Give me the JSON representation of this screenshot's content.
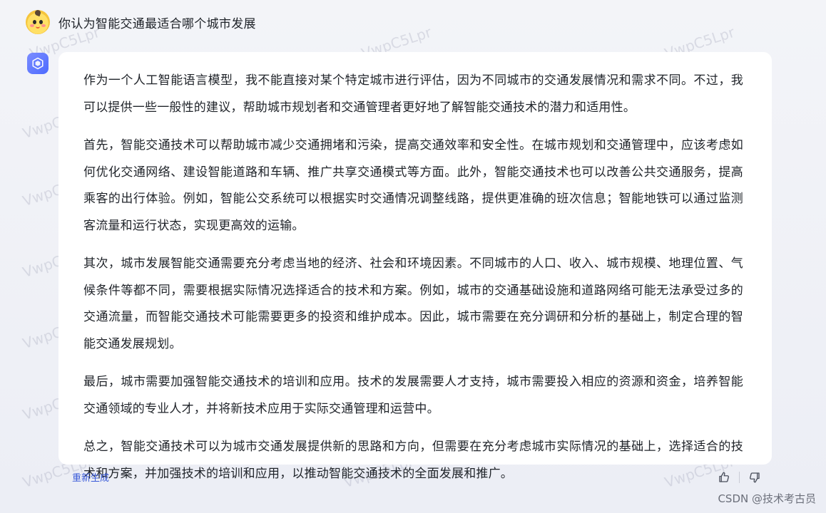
{
  "user": {
    "avatar_icon": "duck-avatar-icon",
    "question": "你认为智能交通最适合哪个城市发展"
  },
  "bot": {
    "avatar_icon": "ai-cube-logo-icon",
    "paragraphs": [
      "作为一个人工智能语言模型，我不能直接对某个特定城市进行评估，因为不同城市的交通发展情况和需求不同。不过，我可以提供一些一般性的建议，帮助城市规划者和交通管理者更好地了解智能交通技术的潜力和适用性。",
      "首先，智能交通技术可以帮助城市减少交通拥堵和污染，提高交通效率和安全性。在城市规划和交通管理中，应该考虑如何优化交通网络、建设智能道路和车辆、推广共享交通模式等方面。此外，智能交通技术也可以改善公共交通服务，提高乘客的出行体验。例如，智能公交系统可以根据实时交通情况调整线路，提供更准确的班次信息；智能地铁可以通过监测客流量和运行状态，实现更高效的运输。",
      "其次，城市发展智能交通需要充分考虑当地的经济、社会和环境因素。不同城市的人口、收入、城市规模、地理位置、气候条件等都不同，需要根据实际情况选择适合的技术和方案。例如，城市的交通基础设施和道路网络可能无法承受过多的交通流量，而智能交通技术可能需要更多的投资和维护成本。因此，城市需要在充分调研和分析的基础上，制定合理的智能交通发展规划。",
      "最后，城市需要加强智能交通技术的培训和应用。技术的发展需要人才支持，城市需要投入相应的资源和资金，培养智能交通领域的专业人才，并将新技术应用于实际交通管理和运营中。",
      "总之，智能交通技术可以为城市交通发展提供新的思路和方向，但需要在充分考虑城市实际情况的基础上，选择适合的技术和方案，并加强技术的培训和应用，以推动智能交通技术的全面发展和推广。"
    ]
  },
  "footer": {
    "regenerate_label": "重新生成",
    "thumbs_up_icon": "thumbs-up-icon",
    "thumbs_down_icon": "thumbs-down-icon"
  },
  "watermark": {
    "text": "VwpC5Lpr",
    "csdn_credit": "CSDN @技术考古员"
  },
  "colors": {
    "page_bg": "#eef0f6",
    "card_bg": "#ffffff",
    "link_blue": "#3a5bd9",
    "bot_avatar": "#5b73ff"
  }
}
